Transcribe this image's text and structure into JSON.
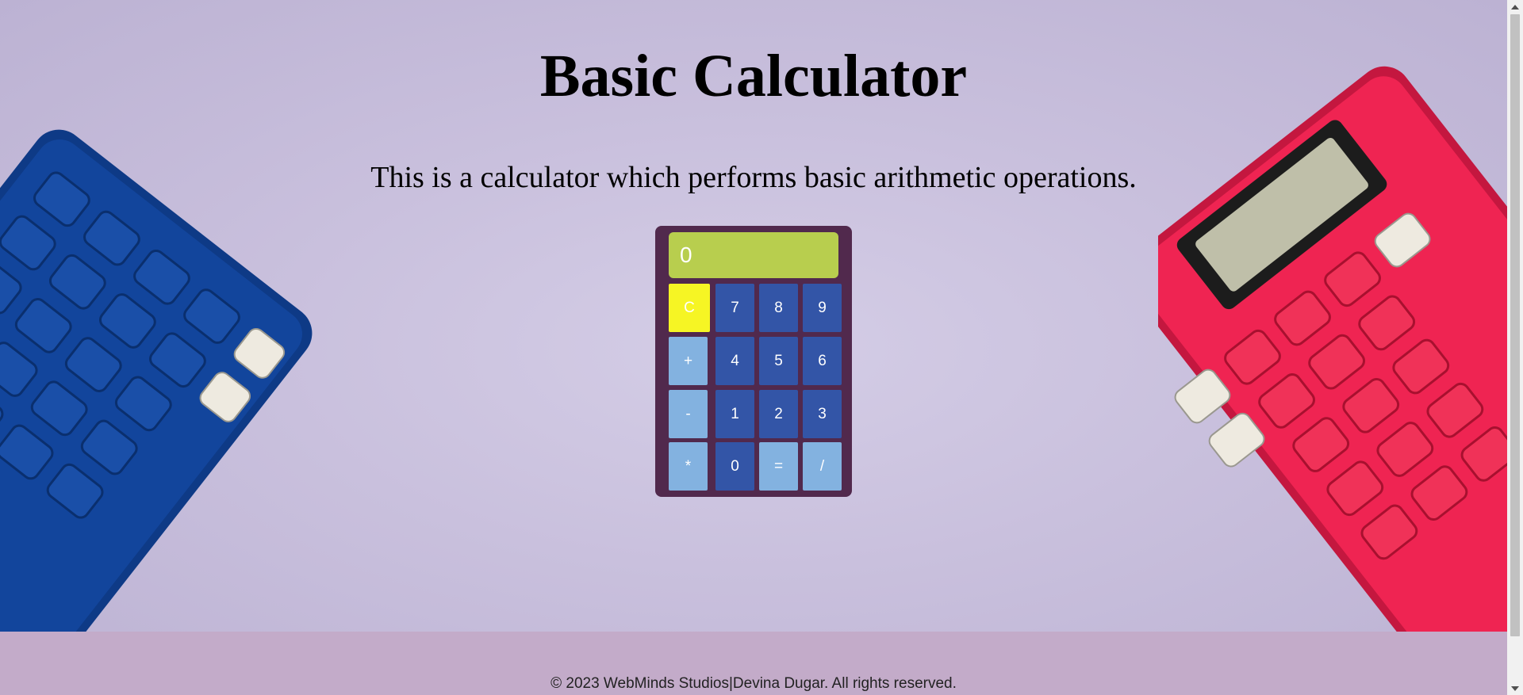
{
  "header": {
    "title": "Basic Calculator",
    "subtitle": "This is a calculator which performs basic arithmetic operations."
  },
  "calculator": {
    "display_value": "0",
    "keys": {
      "clear": "C",
      "seven": "7",
      "eight": "8",
      "nine": "9",
      "plus": "+",
      "four": "4",
      "five": "5",
      "six": "6",
      "minus": "-",
      "one": "1",
      "two": "2",
      "three": "3",
      "multiply": "*",
      "zero": "0",
      "equals": "=",
      "divide": "/"
    }
  },
  "footer": {
    "copyright": "© 2023 WebMinds Studios|Devina Dugar. All rights reserved."
  },
  "colors": {
    "calculator_body": "#51294d",
    "display_bg": "#b8ce4e",
    "digit_key": "#3355a7",
    "operator_key": "#83b2e0",
    "clear_key": "#f6f524",
    "footer_bg": "#c3abc9"
  }
}
